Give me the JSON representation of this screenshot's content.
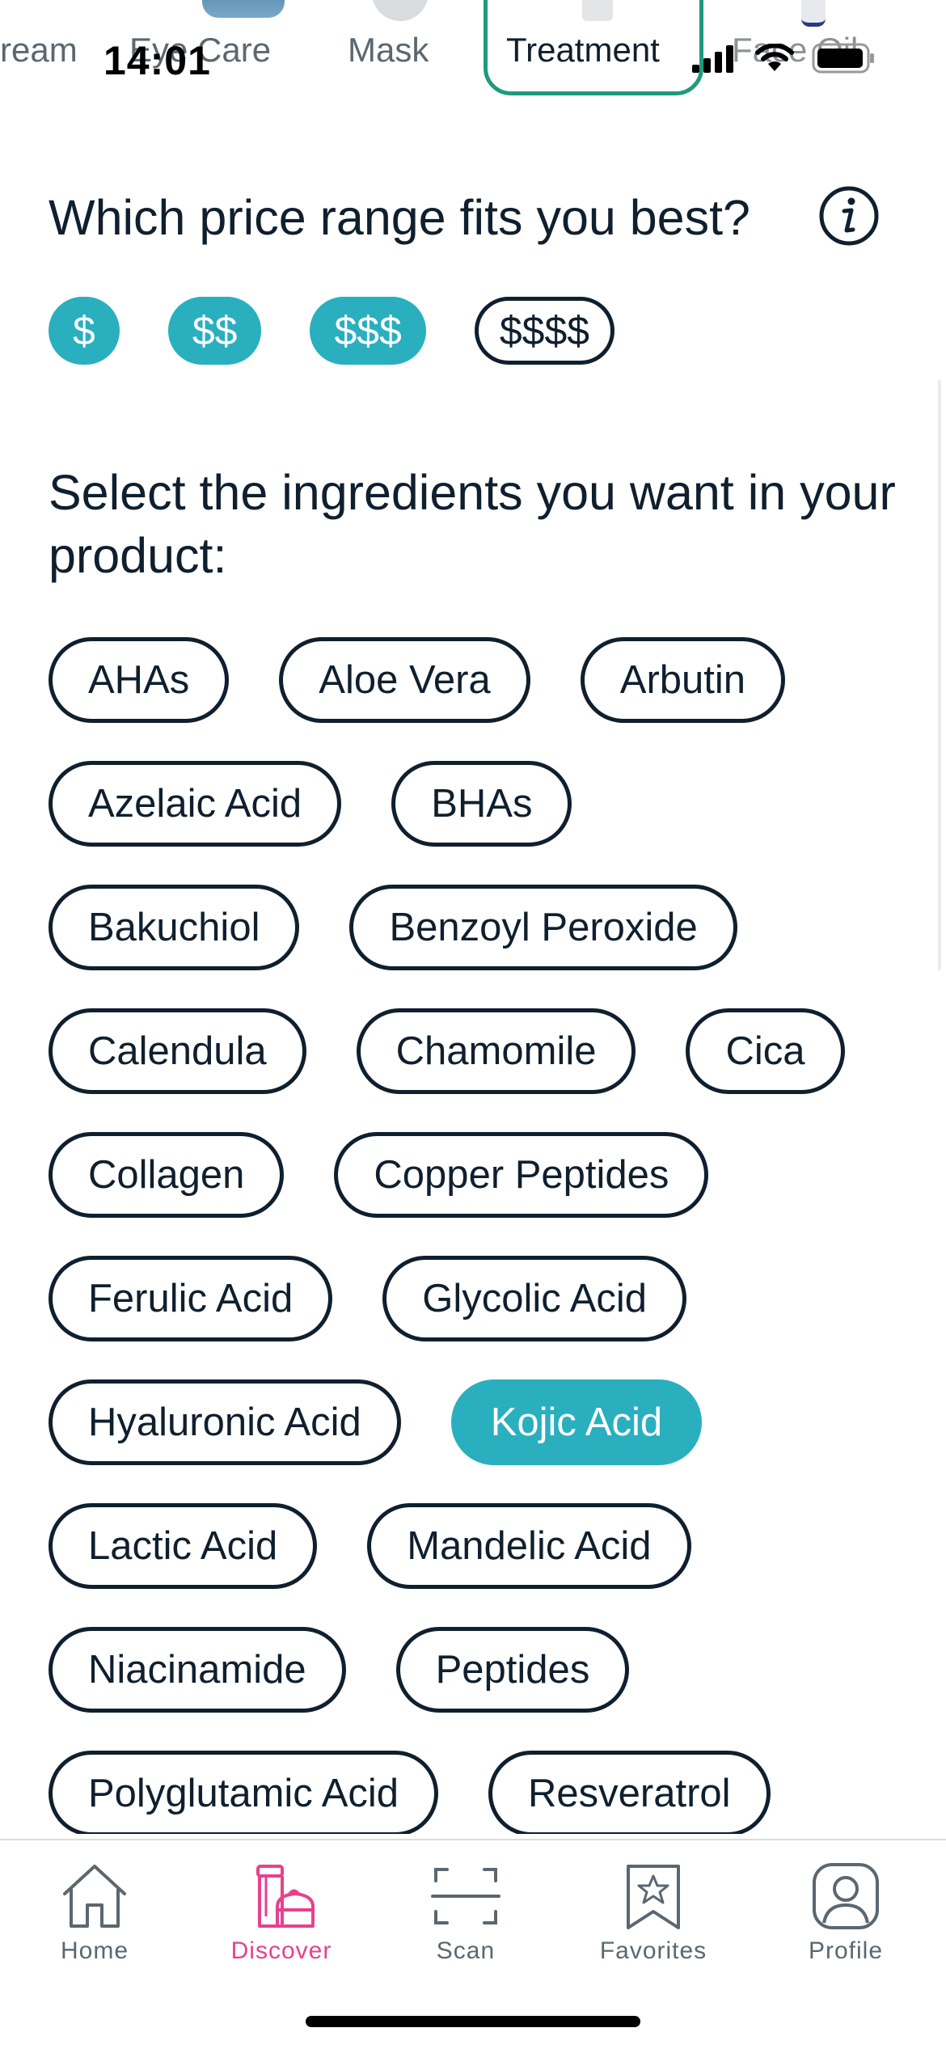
{
  "status_bar": {
    "time": "14:01"
  },
  "categories": [
    {
      "label": "ream"
    },
    {
      "label": "Eye Care"
    },
    {
      "label": "Mask"
    },
    {
      "label": "Treatment"
    },
    {
      "label": "Face Oil"
    }
  ],
  "active_category": "Treatment",
  "price": {
    "heading": "Which price range fits you best?",
    "options": [
      {
        "label": "$",
        "selected": true
      },
      {
        "label": "$$",
        "selected": true
      },
      {
        "label": "$$$",
        "selected": true
      },
      {
        "label": "$$$$",
        "selected": false
      }
    ]
  },
  "ingredients": {
    "heading": "Select the ingredients you want in your product:",
    "rows": [
      [
        "AHAs",
        "Aloe Vera",
        "Arbutin"
      ],
      [
        "Azelaic Acid",
        "BHAs"
      ],
      [
        "Bakuchiol",
        "Benzoyl Peroxide"
      ],
      [
        "Calendula",
        "Chamomile",
        "Cica"
      ],
      [
        "Collagen",
        "Copper Peptides"
      ],
      [
        "Ferulic Acid",
        "Glycolic Acid"
      ],
      [
        "Hyaluronic Acid",
        "Kojic Acid"
      ],
      [
        "Lactic Acid",
        "Mandelic Acid"
      ],
      [
        "Niacinamide",
        "Peptides"
      ],
      [
        "Polyglutamic Acid",
        "Resveratrol"
      ]
    ],
    "selected": [
      "Kojic Acid"
    ]
  },
  "nav": {
    "items": [
      {
        "label": "Home",
        "icon": "home-icon",
        "active": false
      },
      {
        "label": "Discover",
        "icon": "discover-icon",
        "active": true
      },
      {
        "label": "Scan",
        "icon": "scan-icon",
        "active": false
      },
      {
        "label": "Favorites",
        "icon": "favorites-icon",
        "active": false
      },
      {
        "label": "Profile",
        "icon": "profile-icon",
        "active": false
      }
    ]
  },
  "colors": {
    "accent_teal": "#2aafbf",
    "active_category_border": "#1e9a7c",
    "nav_active": "#e8408f",
    "text_dark": "#0f1f2e",
    "nav_inactive": "#5b6770"
  }
}
